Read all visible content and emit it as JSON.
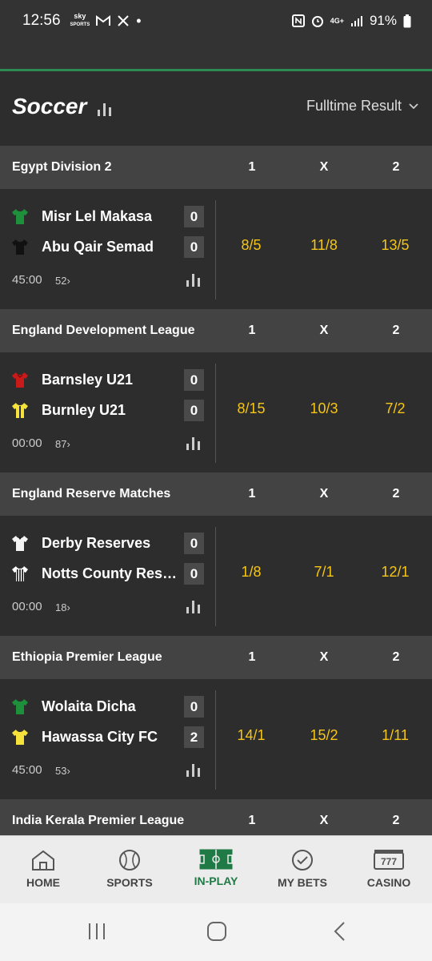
{
  "statusbar": {
    "time": "12:56",
    "sky_label": "sky",
    "sky_sub": "SPORTS",
    "network": "4G+",
    "battery": "91%"
  },
  "header": {
    "title": "Soccer",
    "market": "Fulltime Result"
  },
  "columns": {
    "c1": "1",
    "cx": "X",
    "c2": "2"
  },
  "leagues": [
    {
      "name": "Egypt Division 2",
      "home": {
        "name": "Misr Lel Makasa",
        "score": "0",
        "shirt": "#1e8f3a",
        "stripe": "none"
      },
      "away": {
        "name": "Abu Qair Semad",
        "score": "0",
        "shirt": "#111111",
        "stripe": "none"
      },
      "clock": "45:00",
      "more": "52",
      "odds": [
        "8/5",
        "11/8",
        "13/5"
      ]
    },
    {
      "name": "England Development League",
      "home": {
        "name": "Barnsley U21",
        "score": "0",
        "shirt": "#c91a1a",
        "stripe": "none"
      },
      "away": {
        "name": "Burnley U21",
        "score": "0",
        "shirt": "#f5e23a",
        "stripe": "dark"
      },
      "clock": "00:00",
      "more": "87",
      "odds": [
        "8/15",
        "10/3",
        "7/2"
      ]
    },
    {
      "name": "England Reserve Matches",
      "home": {
        "name": "Derby Reserves",
        "score": "0",
        "shirt": "#f4f4f4",
        "stripe": "none"
      },
      "away": {
        "name": "Notts County Reserves",
        "score": "0",
        "shirt": "#ffffff",
        "stripe": "striped"
      },
      "clock": "00:00",
      "more": "18",
      "odds": [
        "1/8",
        "7/1",
        "12/1"
      ]
    },
    {
      "name": "Ethiopia Premier League",
      "home": {
        "name": "Wolaita Dicha",
        "score": "0",
        "shirt": "#1e8f3a",
        "stripe": "none"
      },
      "away": {
        "name": "Hawassa City FC",
        "score": "2",
        "shirt": "#f5e23a",
        "stripe": "none"
      },
      "clock": "45:00",
      "more": "53",
      "odds": [
        "14/1",
        "15/2",
        "1/11"
      ]
    },
    {
      "name": "India Kerala Premier League"
    }
  ],
  "bottomnav": [
    {
      "label": "HOME",
      "icon": "home-icon"
    },
    {
      "label": "SPORTS",
      "icon": "ball-icon"
    },
    {
      "label": "IN-PLAY",
      "icon": "pitch-icon",
      "active": true
    },
    {
      "label": "MY BETS",
      "icon": "check-icon"
    },
    {
      "label": "CASINO",
      "icon": "slot-icon"
    }
  ],
  "colors": {
    "accent_green": "#1f7a45",
    "odds_yellow": "#f5c518",
    "league_bg": "#434343",
    "page_bg": "#2d2d2d"
  }
}
